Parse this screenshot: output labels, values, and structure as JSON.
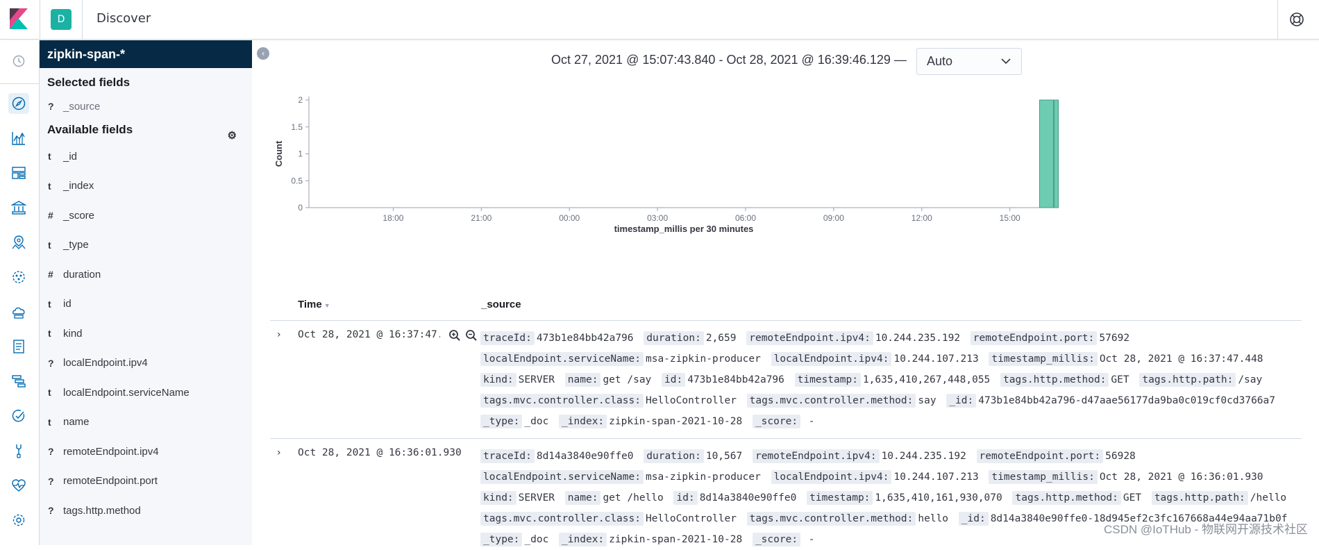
{
  "header": {
    "space_initial": "D",
    "title": "Discover",
    "colors": {
      "space": "#1bb2a4",
      "logo_pink": "#e8478b",
      "logo_teal": "#00bfb3",
      "logo_dark": "#343741"
    }
  },
  "leftnav": {
    "icons": [
      "recent-icon",
      "discover-icon",
      "visualize-icon",
      "dashboard-icon",
      "canvas-icon",
      "maps-icon",
      "ml-icon",
      "infrastructure-icon",
      "logs-icon",
      "apm-icon",
      "uptime-icon",
      "dev-tools-icon",
      "monitoring-icon",
      "management-icon"
    ],
    "active": "discover-icon"
  },
  "sidebar": {
    "index_pattern": "zipkin-span-*",
    "selected_title": "Selected fields",
    "selected_fields": [
      {
        "type": "?",
        "name": "_source"
      }
    ],
    "available_title": "Available fields",
    "available_fields": [
      {
        "type": "t",
        "name": "_id"
      },
      {
        "type": "t",
        "name": "_index"
      },
      {
        "type": "#",
        "name": "_score"
      },
      {
        "type": "t",
        "name": "_type"
      },
      {
        "type": "#",
        "name": "duration"
      },
      {
        "type": "t",
        "name": "id"
      },
      {
        "type": "t",
        "name": "kind"
      },
      {
        "type": "?",
        "name": "localEndpoint.ipv4"
      },
      {
        "type": "t",
        "name": "localEndpoint.serviceName"
      },
      {
        "type": "t",
        "name": "name"
      },
      {
        "type": "?",
        "name": "remoteEndpoint.ipv4"
      },
      {
        "type": "?",
        "name": "remoteEndpoint.port"
      },
      {
        "type": "?",
        "name": "tags.http.method"
      }
    ]
  },
  "main": {
    "time_range": "Oct 27, 2021 @ 15:07:43.840 - Oct 28, 2021 @ 16:39:46.129 —",
    "interval": "Auto"
  },
  "chart_data": {
    "type": "bar",
    "xlabel": "timestamp_millis per 30 minutes",
    "ylabel": "Count",
    "ylim": [
      0,
      2
    ],
    "yticks": [
      "0",
      "0.5",
      "1",
      "1.5",
      "2"
    ],
    "xticks": [
      "18:00",
      "21:00",
      "00:00",
      "03:00",
      "06:00",
      "09:00",
      "12:00",
      "15:00"
    ],
    "x_range": [
      "2021-10-27 15:07:43",
      "2021-10-28 16:39:46"
    ],
    "bars": [
      {
        "x": "2021-10-28 16:00",
        "value": 2
      },
      {
        "x": "2021-10-28 16:30",
        "value": 2
      }
    ],
    "bar_color": "#6dccb1"
  },
  "table": {
    "headers": {
      "time": "Time",
      "source": "_source"
    },
    "rows": [
      {
        "time": "Oct 28, 2021 @ 16:37:47.448",
        "source": [
          [
            "traceId:",
            "473b1e84bb42a796"
          ],
          [
            "duration:",
            "2,659"
          ],
          [
            "remoteEndpoint.ipv4:",
            "10.244.235.192"
          ],
          [
            "remoteEndpoint.port:",
            "57692"
          ],
          [
            "localEndpoint.serviceName:",
            "msa-zipkin-producer"
          ],
          [
            "localEndpoint.ipv4:",
            "10.244.107.213"
          ],
          [
            "timestamp_millis:",
            "Oct 28, 2021 @ 16:37:47.448"
          ],
          [
            "kind:",
            "SERVER"
          ],
          [
            "name:",
            "get /say"
          ],
          [
            "id:",
            "473b1e84bb42a796"
          ],
          [
            "timestamp:",
            "1,635,410,267,448,055"
          ],
          [
            "tags.http.method:",
            "GET"
          ],
          [
            "tags.http.path:",
            "/say"
          ],
          [
            "tags.mvc.controller.class:",
            "HelloController"
          ],
          [
            "tags.mvc.controller.method:",
            "say"
          ],
          [
            "_id:",
            "473b1e84bb42a796-d47aae56177da9ba0c019cf0cd3766a7"
          ],
          [
            "_type:",
            "_doc"
          ],
          [
            "_index:",
            "zipkin-span-2021-10-28"
          ],
          [
            "_score:",
            " -"
          ]
        ]
      },
      {
        "time": "Oct 28, 2021 @ 16:36:01.930",
        "source": [
          [
            "traceId:",
            "8d14a3840e90ffe0"
          ],
          [
            "duration:",
            "10,567"
          ],
          [
            "remoteEndpoint.ipv4:",
            "10.244.235.192"
          ],
          [
            "remoteEndpoint.port:",
            "56928"
          ],
          [
            "localEndpoint.serviceName:",
            "msa-zipkin-producer"
          ],
          [
            "localEndpoint.ipv4:",
            "10.244.107.213"
          ],
          [
            "timestamp_millis:",
            "Oct 28, 2021 @ 16:36:01.930"
          ],
          [
            "kind:",
            "SERVER"
          ],
          [
            "name:",
            "get /hello"
          ],
          [
            "id:",
            "8d14a3840e90ffe0"
          ],
          [
            "timestamp:",
            "1,635,410,161,930,070"
          ],
          [
            "tags.http.method:",
            "GET"
          ],
          [
            "tags.http.path:",
            "/hello"
          ],
          [
            "tags.mvc.controller.class:",
            "HelloController"
          ],
          [
            "tags.mvc.controller.method:",
            "hello"
          ],
          [
            "_id:",
            "8d14a3840e90ffe0-18d945ef2c3fc167668a44e94aa71b0f"
          ],
          [
            "_type:",
            "_doc"
          ],
          [
            "_index:",
            "zipkin-span-2021-10-28"
          ],
          [
            "_score:",
            " -"
          ]
        ]
      }
    ]
  },
  "watermark": "CSDN @IoTHub - 物联网开源技术社区"
}
